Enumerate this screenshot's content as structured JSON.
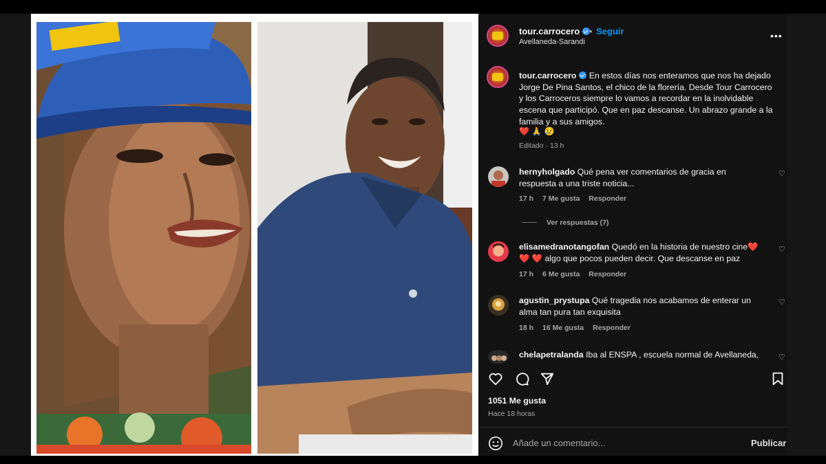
{
  "post": {
    "username": "tour.carrocero",
    "follow_label": "Seguir",
    "dot": "•",
    "location": "Avellaneda-Sarandi",
    "more_icon": "more-horizontal-icon",
    "more_label": "•••"
  },
  "caption": {
    "username": "tour.carrocero",
    "text": "En estos días nos enteramos que nos ha dejado Jorge De Pina Santos, el chico de la florería. Desde Tour Carrocero y los Carroceros siempre lo vamos a recordar en la inolvidable escena que participó. Que en paz descanse. Un abrazo grande a la familia y a sus amigos.",
    "emojis": [
      "❤️",
      "🙏",
      "😢"
    ],
    "time": "Editado · 13 h"
  },
  "comments": [
    {
      "username": "hernyholgado",
      "text": "Qué pena ver comentarios de gracia en respuesta a una triste noticia...",
      "time": "17 h",
      "likes": "7 Me gusta",
      "reply": "Responder",
      "view_replies": "Ver respuestas (7)"
    },
    {
      "username": "elisamedranotangofan",
      "text": "Quedó en la historia de nuestro cine",
      "text2": "algo que pocos pueden decir. Que descanse en paz",
      "time": "17 h",
      "likes": "6 Me gusta",
      "reply": "Responder"
    },
    {
      "username": "agustin_prystupa",
      "text": "Qué tragedia nos acabamos de enterar un alma tan pura tan exquisita",
      "time": "18 h",
      "likes": "16 Me gusta",
      "reply": "Responder"
    },
    {
      "username": "chelapetralanda",
      "text": "Iba al ENSPA , escuela normal de Avellaneda,"
    }
  ],
  "engagement": {
    "likes": "1051 Me gusta",
    "posted": "Hace 18 horas"
  },
  "add_comment": {
    "placeholder": "Añade un comentario...",
    "publish": "Publicar"
  },
  "colors": {
    "accent": "#0095f6",
    "panel_bg": "#121212",
    "heart": "#ed4956",
    "verified": "#3897f0"
  }
}
